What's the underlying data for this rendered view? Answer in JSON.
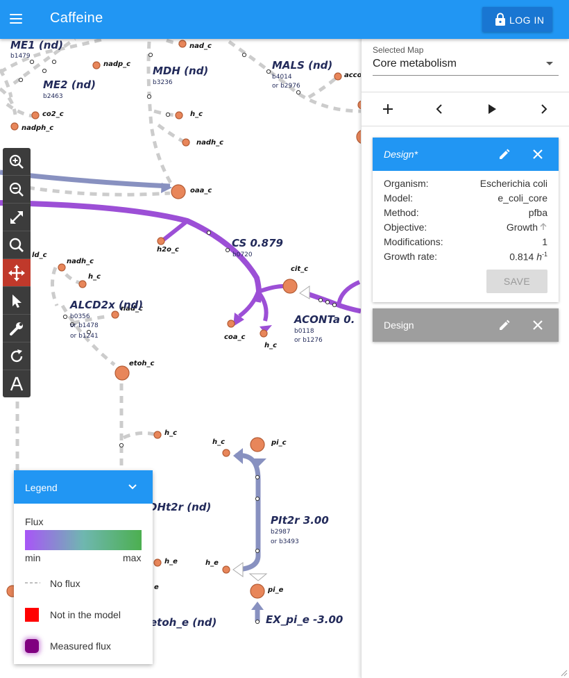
{
  "app": {
    "title": "Caffeine",
    "login_label": "LOG IN"
  },
  "map": {
    "metabolites": [
      {
        "label": "nad_c"
      },
      {
        "label": "nadp_c"
      },
      {
        "label": "co2_c"
      },
      {
        "label": "nadph_c"
      },
      {
        "label": "h_c"
      },
      {
        "label": "nadh_c"
      },
      {
        "label": "oaa_c"
      },
      {
        "label": "acco"
      },
      {
        "label": "h2o_c"
      },
      {
        "label": "cit_c"
      },
      {
        "label": "ld_c"
      },
      {
        "label": "nadh_c"
      },
      {
        "label": "h_c"
      },
      {
        "label": "nad_c"
      },
      {
        "label": "coa_c"
      },
      {
        "label": "h_c"
      },
      {
        "label": "etoh_c"
      },
      {
        "label": "h_c"
      },
      {
        "label": "h_c"
      },
      {
        "label": "pi_c"
      },
      {
        "label": "h_e"
      },
      {
        "label": "h_e"
      },
      {
        "label": "e"
      },
      {
        "label": "pi_e"
      }
    ],
    "reactions": [
      {
        "name": "ME1 (nd)",
        "genes": [
          "b1479"
        ]
      },
      {
        "name": "ME2 (nd)",
        "genes": [
          "b2463"
        ]
      },
      {
        "name": "MDH (nd)",
        "genes": [
          "b3236"
        ]
      },
      {
        "name": "MALS (nd)",
        "genes": [
          "b4014",
          "or b2976"
        ]
      },
      {
        "name": "CS 0.879",
        "genes": [
          "b0720"
        ]
      },
      {
        "name": "ALCD2x (nd)",
        "genes": [
          "b0356",
          "or b1478",
          "or b1241"
        ]
      },
      {
        "name": "ACONTa 0.",
        "genes": [
          "b0118",
          "or b1276"
        ]
      },
      {
        "name": "DHt2r (nd)",
        "genes": []
      },
      {
        "name": "PIt2r 3.00",
        "genes": [
          "b2987",
          "or b3493"
        ]
      },
      {
        "name": "EX_pi_e -3.00",
        "genes": []
      },
      {
        "name": "etoh_e (nd)",
        "genes": []
      }
    ]
  },
  "toolbar": {
    "tools": [
      {
        "icon": "zoom-in-icon"
      },
      {
        "icon": "zoom-out-icon"
      },
      {
        "icon": "fullscreen-icon"
      },
      {
        "icon": "search-icon"
      },
      {
        "icon": "pan-icon",
        "active": true
      },
      {
        "icon": "select-icon"
      },
      {
        "icon": "wrench-icon"
      },
      {
        "icon": "rotate-icon"
      },
      {
        "icon": "text-icon"
      }
    ]
  },
  "legend": {
    "title": "Legend",
    "flux_label": "Flux",
    "min_label": "min",
    "max_label": "max",
    "no_flux_label": "No flux",
    "not_in_model_label": "Not in the model",
    "measured_flux_label": "Measured flux",
    "colors": {
      "min": "#a855f7",
      "mid": "#6fb7b0",
      "max": "#4caf50",
      "not_in_model": "#ff0000",
      "measured": "#800080"
    }
  },
  "panel": {
    "selected_map_label": "Selected Map",
    "selected_map_value": "Core metabolism",
    "design_active": {
      "title": "Design*",
      "fields": [
        {
          "key": "Organism:",
          "value": "Escherichia coli"
        },
        {
          "key": "Model:",
          "value": "e_coli_core"
        },
        {
          "key": "Method:",
          "value": "pfba"
        },
        {
          "key": "Objective:",
          "value": "Growth"
        },
        {
          "key": "Modifications:",
          "value": "1"
        },
        {
          "key": "Growth rate:",
          "value": "0.814"
        }
      ],
      "growth_unit": "h",
      "growth_unit_exp": "-1",
      "save_label": "SAVE"
    },
    "design_inactive": {
      "title": "Design"
    }
  },
  "colors": {
    "primary": "#2196f3",
    "primary_dark": "#1976d2",
    "card_inactive": "#9e9e9e",
    "metabolite": "#e8865a",
    "flux_purple": "#9c4fd6",
    "flux_blue": "#8891c0",
    "no_flux": "#cccccc"
  }
}
